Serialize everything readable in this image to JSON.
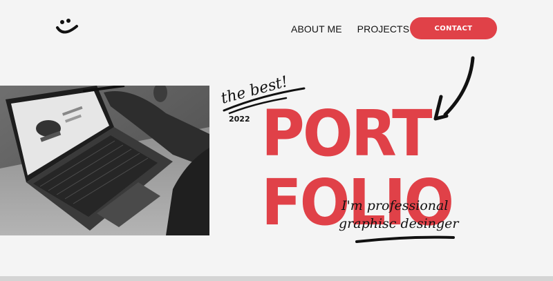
{
  "logo": {
    "icon": "smiley-icon"
  },
  "nav": {
    "about": "ABOUT ME",
    "projects": "PROJECTS",
    "contact": "CONTACT"
  },
  "hero": {
    "tagline": "the best!",
    "year": "2022",
    "title_line1": "PORT",
    "title_line2": "FOLIO",
    "subtitle_line1": "I'm professional",
    "subtitle_line2": "graphisc desinger"
  },
  "colors": {
    "accent": "#e04148",
    "background": "#f4f4f4",
    "text": "#111111"
  }
}
